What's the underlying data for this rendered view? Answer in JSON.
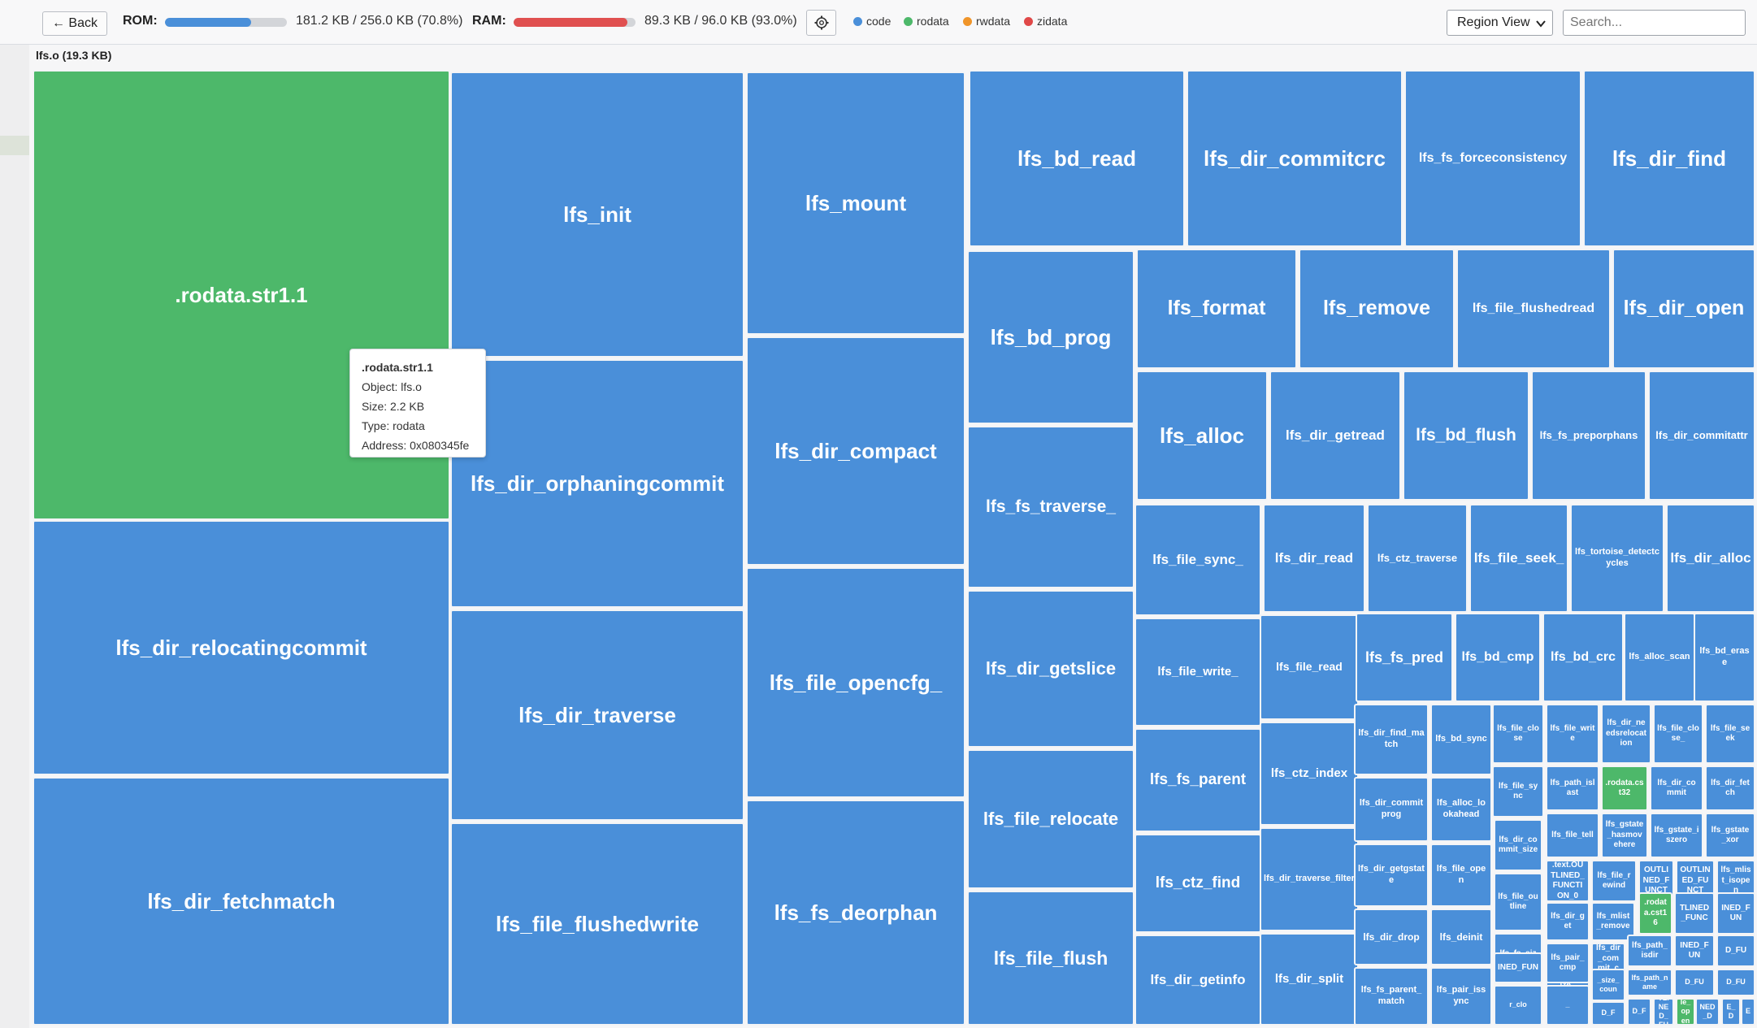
{
  "toolbar": {
    "back_label": "← Back",
    "rom": {
      "label": "ROM:",
      "text": "181.2 KB / 256.0 KB (70.8%)",
      "fraction": 0.708,
      "color": "#4a8fd9"
    },
    "ram": {
      "label": "RAM:",
      "text": "89.3 KB / 96.0 KB (93.0%)",
      "fraction": 0.93,
      "color": "#e05050"
    },
    "settings_icon": "gear-icon",
    "legend": [
      {
        "label": "code",
        "color": "#4a8fd9"
      },
      {
        "label": "rodata",
        "color": "#4db86a"
      },
      {
        "label": "rwdata",
        "color": "#f0952a"
      },
      {
        "label": "zidata",
        "color": "#e04848"
      }
    ],
    "view_select": "Region View",
    "search_placeholder": "Search..."
  },
  "breadcrumb": "lfs.o (19.3 KB)",
  "colors": {
    "code": "#4a8fd9",
    "rodata": "#4db86a"
  },
  "tooltip": {
    "name": ".rodata.str1.1",
    "object": "Object: lfs.o",
    "size": "Size: 2.2 KB",
    "type": "Type: rodata",
    "address": "Address: 0x080345fe"
  },
  "cells": [
    {
      "label": ".rodata.str1.1",
      "type": "rodata"
    },
    {
      "label": "lfs_dir_relocatingcommit",
      "type": "code"
    },
    {
      "label": "lfs_dir_fetchmatch",
      "type": "code"
    },
    {
      "label": "lfs_init",
      "type": "code"
    },
    {
      "label": "lfs_dir_orphaningcommit",
      "type": "code"
    },
    {
      "label": "lfs_dir_traverse",
      "type": "code"
    },
    {
      "label": "lfs_file_flushedwrite",
      "type": "code"
    },
    {
      "label": "lfs_mount",
      "type": "code"
    },
    {
      "label": "lfs_dir_compact",
      "type": "code"
    },
    {
      "label": "lfs_file_opencfg_",
      "type": "code"
    },
    {
      "label": "lfs_fs_deorphan",
      "type": "code"
    },
    {
      "label": "lfs_bd_read",
      "type": "code"
    },
    {
      "label": "lfs_dir_commitcrc",
      "type": "code"
    },
    {
      "label": "lfs_fs_forceconsistency",
      "type": "code"
    },
    {
      "label": "lfs_dir_find",
      "type": "code"
    },
    {
      "label": "lfs_bd_prog",
      "type": "code"
    },
    {
      "label": "lfs_fs_traverse_",
      "type": "code"
    },
    {
      "label": "lfs_dir_getslice",
      "type": "code"
    },
    {
      "label": "lfs_file_relocate",
      "type": "code"
    },
    {
      "label": "lfs_file_flush",
      "type": "code"
    },
    {
      "label": "lfs_format",
      "type": "code"
    },
    {
      "label": "lfs_remove",
      "type": "code"
    },
    {
      "label": "lfs_file_flushedread",
      "type": "code"
    },
    {
      "label": "lfs_dir_open",
      "type": "code"
    },
    {
      "label": "lfs_alloc",
      "type": "code"
    },
    {
      "label": "lfs_dir_getread",
      "type": "code"
    },
    {
      "label": "lfs_bd_flush",
      "type": "code"
    },
    {
      "label": "lfs_fs_preporphans",
      "type": "code"
    },
    {
      "label": "lfs_dir_commitattr",
      "type": "code"
    },
    {
      "label": "lfs_file_sync_",
      "type": "code"
    },
    {
      "label": "lfs_dir_read",
      "type": "code"
    },
    {
      "label": "lfs_ctz_traverse",
      "type": "code"
    },
    {
      "label": "lfs_file_seek_",
      "type": "code"
    },
    {
      "label": "lfs_tortoise_detectcycles",
      "type": "code"
    },
    {
      "label": "lfs_dir_alloc",
      "type": "code"
    },
    {
      "label": "lfs_file_write_",
      "type": "code"
    },
    {
      "label": "lfs_fs_parent",
      "type": "code"
    },
    {
      "label": "lfs_ctz_find",
      "type": "code"
    },
    {
      "label": "lfs_dir_getinfo",
      "type": "code"
    },
    {
      "label": "lfs_file_read",
      "type": "code"
    },
    {
      "label": "lfs_ctz_index",
      "type": "code"
    },
    {
      "label": "lfs_dir_traverse_filter",
      "type": "code"
    },
    {
      "label": "lfs_dir_split",
      "type": "code"
    },
    {
      "label": "lfs_fs_pred",
      "type": "code"
    },
    {
      "label": "lfs_bd_cmp",
      "type": "code"
    },
    {
      "label": "lfs_bd_crc",
      "type": "code"
    },
    {
      "label": "lfs_alloc_scan",
      "type": "code"
    },
    {
      "label": "lfs_bd_erase",
      "type": "code"
    },
    {
      "label": "lfs_dir_find_match",
      "type": "code"
    },
    {
      "label": "lfs_bd_sync",
      "type": "code"
    },
    {
      "label": "lfs_dir_commitprog",
      "type": "code"
    },
    {
      "label": "lfs_alloc_lookahead",
      "type": "code"
    },
    {
      "label": "lfs_dir_getgstate",
      "type": "code"
    },
    {
      "label": "lfs_file_open",
      "type": "code"
    },
    {
      "label": "lfs_dir_drop",
      "type": "code"
    },
    {
      "label": "lfs_deinit",
      "type": "code"
    },
    {
      "label": "lfs_fs_parent_match",
      "type": "code"
    },
    {
      "label": "lfs_pair_issync",
      "type": "code"
    },
    {
      "label": "lfs_file_close",
      "type": "code"
    },
    {
      "label": "lfs_file_write",
      "type": "code"
    },
    {
      "label": "lfs_dir_needsrelocation",
      "type": "code"
    },
    {
      "label": "lfs_file_close_",
      "type": "code"
    },
    {
      "label": "lfs_file_seek",
      "type": "code"
    },
    {
      "label": "lfs_file_sync",
      "type": "code"
    },
    {
      "label": "lfs_path_islast",
      "type": "code"
    },
    {
      "label": ".rodata.cst32",
      "type": "rodata"
    },
    {
      "label": "lfs_dir_commit",
      "type": "code"
    },
    {
      "label": "lfs_dir_fetch",
      "type": "code"
    },
    {
      "label": "lfs_dir_commit_size",
      "type": "code"
    },
    {
      "label": "lfs_file_tell",
      "type": "code"
    },
    {
      "label": "lfs_gstate_hasmovehere",
      "type": "code"
    },
    {
      "label": "lfs_gstate_iszero",
      "type": "code"
    },
    {
      "label": "lfs_gstate_xor",
      "type": "code"
    },
    {
      "label": "lfs_file_outline",
      "type": "code"
    },
    {
      "label": ".text.OUTLINED_FUNCTION_0",
      "type": "code"
    },
    {
      "label": "lfs_file_rewind",
      "type": "code"
    },
    {
      "label": "OUTLINED_FUNCT",
      "type": "code"
    },
    {
      "label": "OUTLINED_FUNCT",
      "type": "code"
    },
    {
      "label": "lfs_mlist_isopen",
      "type": "code"
    },
    {
      "label": "lfs_fs_size_",
      "type": "code"
    },
    {
      "label": "lfs_dir_get",
      "type": "code"
    },
    {
      "label": "lfs_mlist_remove",
      "type": "code"
    },
    {
      "label": ".rodata.cst16",
      "type": "rodata"
    },
    {
      "label": "TLINED_FUNC",
      "type": "code"
    },
    {
      "label": "INED_FUN",
      "type": "code"
    },
    {
      "label": "INED_FUN",
      "type": "code"
    },
    {
      "label": "lfs_file_size_",
      "type": "code"
    },
    {
      "label": "lfs_pair_cmp",
      "type": "code"
    },
    {
      "label": "lfs_dir_commit_commit",
      "type": "code"
    },
    {
      "label": "lfs_path_isdir",
      "type": "code"
    },
    {
      "label": "INED_FUN",
      "type": "code"
    },
    {
      "label": "D_FU",
      "type": "code"
    },
    {
      "label": "r_clo",
      "type": "code"
    },
    {
      "label": "_size_coun",
      "type": "code"
    },
    {
      "label": "lfs_path_name",
      "type": "code"
    },
    {
      "label": "D_FU",
      "type": "code"
    },
    {
      "label": "D_FU",
      "type": "code"
    },
    {
      "label": "_",
      "type": "code"
    },
    {
      "label": "D_F",
      "type": "code"
    },
    {
      "label": "D_F",
      "type": "code"
    },
    {
      "label": "OUTLINED_FUNC",
      "type": "code"
    },
    {
      "label": "le_open",
      "type": "rodata"
    },
    {
      "label": "NED_D",
      "type": "code"
    },
    {
      "label": "E_D",
      "type": "code"
    },
    {
      "label": "E",
      "type": "code"
    },
    {
      "label": "E",
      "type": "code"
    },
    {
      "label": "D_F",
      "type": "code"
    },
    {
      "label": "lfs_s",
      "type": "code"
    }
  ]
}
